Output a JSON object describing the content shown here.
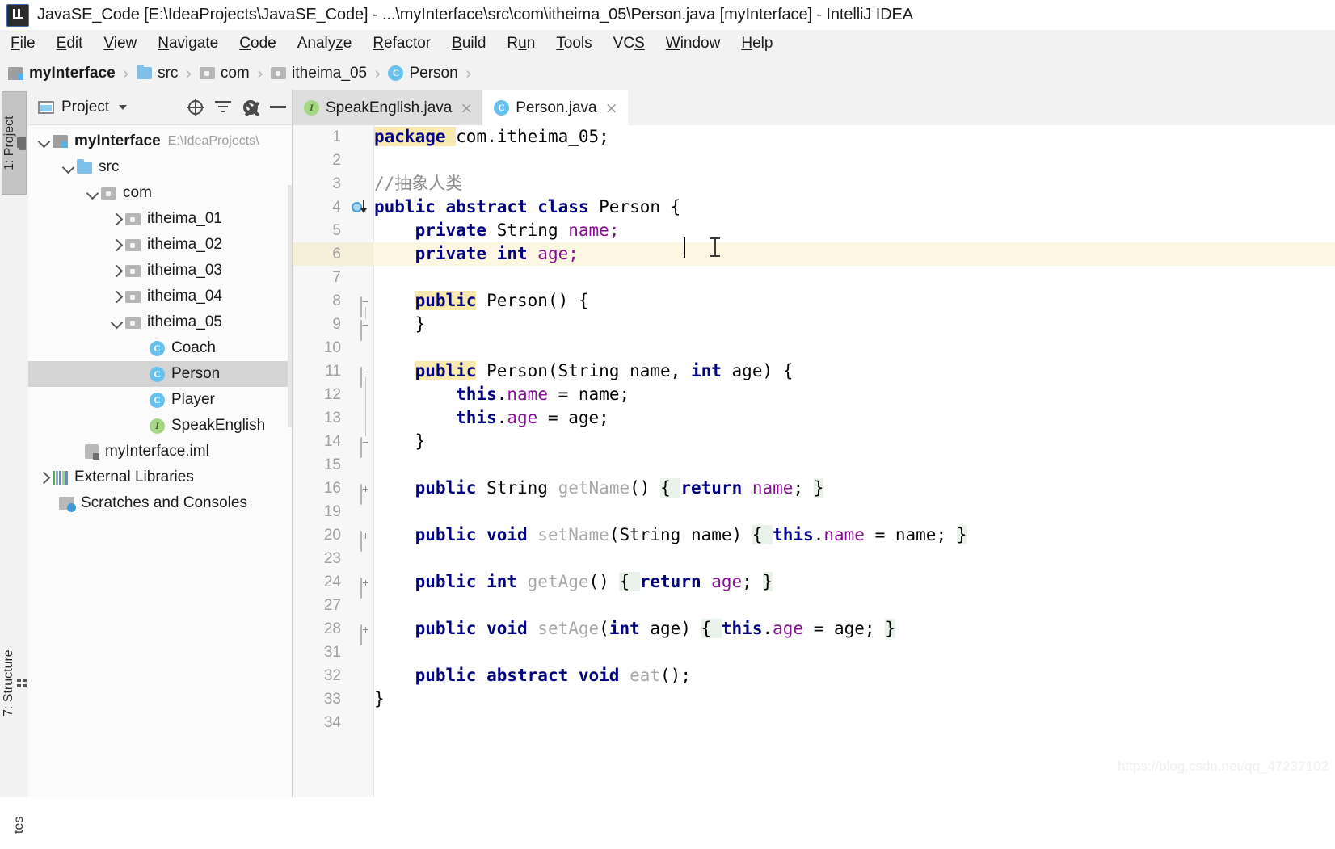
{
  "window": {
    "title": "JavaSE_Code [E:\\IdeaProjects\\JavaSE_Code] - ...\\myInterface\\src\\com\\itheima_05\\Person.java [myInterface] - IntelliJ IDEA",
    "app_name": "IntelliJ IDEA",
    "logo_icon": "intellij-idea-logo-icon"
  },
  "menubar": {
    "items": [
      {
        "label": "File",
        "mnemonic": "F"
      },
      {
        "label": "Edit",
        "mnemonic": "E"
      },
      {
        "label": "View",
        "mnemonic": "V"
      },
      {
        "label": "Navigate",
        "mnemonic": "N"
      },
      {
        "label": "Code",
        "mnemonic": "C"
      },
      {
        "label": "Analyze",
        "mnemonic": "z"
      },
      {
        "label": "Refactor",
        "mnemonic": "R"
      },
      {
        "label": "Build",
        "mnemonic": "B"
      },
      {
        "label": "Run",
        "mnemonic": "u"
      },
      {
        "label": "Tools",
        "mnemonic": "T"
      },
      {
        "label": "VCS",
        "mnemonic": "S"
      },
      {
        "label": "Window",
        "mnemonic": "W"
      },
      {
        "label": "Help",
        "mnemonic": "H"
      }
    ]
  },
  "breadcrumb": {
    "separator": "›",
    "items": [
      {
        "label": "myInterface",
        "icon": "module-icon",
        "bold": true
      },
      {
        "label": "src",
        "icon": "source-folder-icon",
        "bold": false
      },
      {
        "label": "com",
        "icon": "package-icon",
        "bold": false
      },
      {
        "label": "itheima_05",
        "icon": "package-icon",
        "bold": false
      },
      {
        "label": "Person",
        "icon": "java-class-icon",
        "bold": false
      }
    ]
  },
  "left_toolwindows": [
    {
      "label": "1: Project",
      "icon": "project-folder-icon",
      "active": true
    },
    {
      "label": "7: Structure",
      "icon": "structure-icon",
      "active": false
    },
    {
      "label": "tes",
      "icon": "favorites-icon",
      "active": false
    }
  ],
  "project_panel": {
    "title": "Project",
    "view_icon": "project-view-icon",
    "dropdown_icon": "chevron-down-icon",
    "actions": [
      {
        "name": "locate-in-tree-button",
        "icon": "locate-icon"
      },
      {
        "name": "collapse-all-button",
        "icon": "collapse-all-icon"
      },
      {
        "name": "settings-button",
        "icon": "gear-icon"
      },
      {
        "name": "hide-panel-button",
        "icon": "minimize-icon"
      }
    ],
    "tree": [
      {
        "label": "myInterface",
        "sublabel": "E:\\IdeaProjects\\",
        "indent": 0,
        "arrow": "down",
        "icon": "module-icon",
        "bold": true,
        "selected": false
      },
      {
        "label": "src",
        "sublabel": "",
        "indent": 1,
        "arrow": "down",
        "icon": "source-folder-icon",
        "bold": false,
        "selected": false
      },
      {
        "label": "com",
        "sublabel": "",
        "indent": 2,
        "arrow": "down",
        "icon": "package-icon",
        "bold": false,
        "selected": false
      },
      {
        "label": "itheima_01",
        "sublabel": "",
        "indent": 3,
        "arrow": "right",
        "icon": "package-icon",
        "bold": false,
        "selected": false
      },
      {
        "label": "itheima_02",
        "sublabel": "",
        "indent": 3,
        "arrow": "right",
        "icon": "package-icon",
        "bold": false,
        "selected": false
      },
      {
        "label": "itheima_03",
        "sublabel": "",
        "indent": 3,
        "arrow": "right",
        "icon": "package-icon",
        "bold": false,
        "selected": false
      },
      {
        "label": "itheima_04",
        "sublabel": "",
        "indent": 3,
        "arrow": "right",
        "icon": "package-icon",
        "bold": false,
        "selected": false
      },
      {
        "label": "itheima_05",
        "sublabel": "",
        "indent": 3,
        "arrow": "down",
        "icon": "package-icon",
        "bold": false,
        "selected": false
      },
      {
        "label": "Coach",
        "sublabel": "",
        "indent": 4,
        "arrow": "none",
        "icon": "java-class-icon",
        "bold": false,
        "selected": false
      },
      {
        "label": "Person",
        "sublabel": "",
        "indent": 4,
        "arrow": "none",
        "icon": "java-class-icon",
        "bold": false,
        "selected": true
      },
      {
        "label": "Player",
        "sublabel": "",
        "indent": 4,
        "arrow": "none",
        "icon": "java-class-icon",
        "bold": false,
        "selected": false
      },
      {
        "label": "SpeakEnglish",
        "sublabel": "",
        "indent": 4,
        "arrow": "none",
        "icon": "java-interface-icon",
        "bold": false,
        "selected": false
      },
      {
        "label": "myInterface.iml",
        "sublabel": "",
        "indent": 2,
        "arrow": "none",
        "icon": "iml-file-icon",
        "bold": false,
        "selected": false
      },
      {
        "label": "External Libraries",
        "sublabel": "",
        "indent": 0,
        "arrow": "right",
        "icon": "libraries-icon",
        "bold": false,
        "selected": false
      },
      {
        "label": "Scratches and Consoles",
        "sublabel": "",
        "indent": 1,
        "arrow": "none",
        "icon": "scratches-icon",
        "bold": false,
        "selected": false
      }
    ]
  },
  "editor": {
    "tabs": [
      {
        "label": "SpeakEnglish.java",
        "icon": "java-interface-icon",
        "active": false,
        "close": "×"
      },
      {
        "label": "Person.java",
        "icon": "java-class-icon",
        "active": true,
        "close": "×"
      }
    ],
    "current_line": 6,
    "lines": [
      {
        "num": "1",
        "fold": "none",
        "tokens": [
          {
            "t": "package ",
            "c": "kw-hl"
          },
          {
            "t": "com.itheima_05;",
            "c": "txt"
          }
        ]
      },
      {
        "num": "2",
        "fold": "none",
        "tokens": []
      },
      {
        "num": "3",
        "fold": "none",
        "tokens": [
          {
            "t": "//抽象人类",
            "c": "cmt"
          }
        ]
      },
      {
        "num": "4",
        "fold": "none",
        "gutter": "implemented-by-icon",
        "tokens": [
          {
            "t": "public abstract class ",
            "c": "kw"
          },
          {
            "t": "Person {",
            "c": "txt"
          }
        ]
      },
      {
        "num": "5",
        "fold": "none",
        "tokens": [
          {
            "t": "    ",
            "c": "txt"
          },
          {
            "t": "private ",
            "c": "kw"
          },
          {
            "t": "String ",
            "c": "txt"
          },
          {
            "t": "name;",
            "c": "fld"
          }
        ]
      },
      {
        "num": "6",
        "fold": "none",
        "tokens": [
          {
            "t": "    ",
            "c": "txt"
          },
          {
            "t": "private int ",
            "c": "kw"
          },
          {
            "t": "age;",
            "c": "fld"
          }
        ]
      },
      {
        "num": "7",
        "fold": "none",
        "tokens": []
      },
      {
        "num": "8",
        "fold": "minus",
        "tokens": [
          {
            "t": "    ",
            "c": "txt"
          },
          {
            "t": "public",
            "c": "kw-hl"
          },
          {
            "t": " Person() {",
            "c": "txt"
          }
        ]
      },
      {
        "num": "9",
        "fold": "minus-end",
        "tokens": [
          {
            "t": "    }",
            "c": "txt"
          }
        ]
      },
      {
        "num": "10",
        "fold": "none",
        "tokens": []
      },
      {
        "num": "11",
        "fold": "minus",
        "tokens": [
          {
            "t": "    ",
            "c": "txt"
          },
          {
            "t": "public",
            "c": "kw-hl"
          },
          {
            "t": " Person(String name, ",
            "c": "txt"
          },
          {
            "t": "int",
            "c": "kw"
          },
          {
            "t": " age) {",
            "c": "txt"
          }
        ]
      },
      {
        "num": "12",
        "fold": "none",
        "tokens": [
          {
            "t": "        ",
            "c": "txt"
          },
          {
            "t": "this",
            "c": "kw"
          },
          {
            "t": ".",
            "c": "txt"
          },
          {
            "t": "name",
            "c": "fld"
          },
          {
            "t": " = name;",
            "c": "txt"
          }
        ]
      },
      {
        "num": "13",
        "fold": "none",
        "tokens": [
          {
            "t": "        ",
            "c": "txt"
          },
          {
            "t": "this",
            "c": "kw"
          },
          {
            "t": ".",
            "c": "txt"
          },
          {
            "t": "age",
            "c": "fld"
          },
          {
            "t": " = age;",
            "c": "txt"
          }
        ]
      },
      {
        "num": "14",
        "fold": "minus-end",
        "tokens": [
          {
            "t": "    }",
            "c": "txt"
          }
        ]
      },
      {
        "num": "15",
        "fold": "none",
        "tokens": []
      },
      {
        "num": "16",
        "fold": "plus",
        "tokens": [
          {
            "t": "    ",
            "c": "txt"
          },
          {
            "t": "public ",
            "c": "kw"
          },
          {
            "t": "String ",
            "c": "txt"
          },
          {
            "t": "getName",
            "c": "mth"
          },
          {
            "t": "() ",
            "c": "txt"
          },
          {
            "t": "{ ",
            "c": "fold-bg"
          },
          {
            "t": "return ",
            "c": "kw"
          },
          {
            "t": "name",
            "c": "fld"
          },
          {
            "t": "; ",
            "c": "txt"
          },
          {
            "t": "}",
            "c": "fold-bg"
          }
        ]
      },
      {
        "num": "19",
        "fold": "none",
        "tokens": []
      },
      {
        "num": "20",
        "fold": "plus",
        "tokens": [
          {
            "t": "    ",
            "c": "txt"
          },
          {
            "t": "public void ",
            "c": "kw"
          },
          {
            "t": "setName",
            "c": "mth"
          },
          {
            "t": "(String name) ",
            "c": "txt"
          },
          {
            "t": "{ ",
            "c": "fold-bg"
          },
          {
            "t": "this",
            "c": "kw"
          },
          {
            "t": ".",
            "c": "txt"
          },
          {
            "t": "name",
            "c": "fld"
          },
          {
            "t": " = name; ",
            "c": "txt"
          },
          {
            "t": "}",
            "c": "fold-bg"
          }
        ]
      },
      {
        "num": "23",
        "fold": "none",
        "tokens": []
      },
      {
        "num": "24",
        "fold": "plus",
        "tokens": [
          {
            "t": "    ",
            "c": "txt"
          },
          {
            "t": "public int ",
            "c": "kw"
          },
          {
            "t": "getAge",
            "c": "mth"
          },
          {
            "t": "() ",
            "c": "txt"
          },
          {
            "t": "{ ",
            "c": "fold-bg"
          },
          {
            "t": "return ",
            "c": "kw"
          },
          {
            "t": "age",
            "c": "fld"
          },
          {
            "t": "; ",
            "c": "txt"
          },
          {
            "t": "}",
            "c": "fold-bg"
          }
        ]
      },
      {
        "num": "27",
        "fold": "none",
        "tokens": []
      },
      {
        "num": "28",
        "fold": "plus",
        "tokens": [
          {
            "t": "    ",
            "c": "txt"
          },
          {
            "t": "public void ",
            "c": "kw"
          },
          {
            "t": "setAge",
            "c": "mth"
          },
          {
            "t": "(",
            "c": "txt"
          },
          {
            "t": "int",
            "c": "kw"
          },
          {
            "t": " age) ",
            "c": "txt"
          },
          {
            "t": "{ ",
            "c": "fold-bg"
          },
          {
            "t": "this",
            "c": "kw"
          },
          {
            "t": ".",
            "c": "txt"
          },
          {
            "t": "age",
            "c": "fld"
          },
          {
            "t": " = age; ",
            "c": "txt"
          },
          {
            "t": "}",
            "c": "fold-bg"
          }
        ]
      },
      {
        "num": "31",
        "fold": "none",
        "tokens": []
      },
      {
        "num": "32",
        "fold": "none",
        "tokens": [
          {
            "t": "    ",
            "c": "txt"
          },
          {
            "t": "public abstract void ",
            "c": "kw"
          },
          {
            "t": "eat",
            "c": "mth"
          },
          {
            "t": "();",
            "c": "txt"
          }
        ]
      },
      {
        "num": "33",
        "fold": "none",
        "tokens": [
          {
            "t": "}",
            "c": "txt"
          }
        ]
      },
      {
        "num": "34",
        "fold": "none",
        "tokens": []
      }
    ]
  },
  "watermark": {
    "text": "https://blog.csdn.net/qq_47237102"
  },
  "colors": {
    "keyword": "#000080",
    "field": "#871094",
    "method": "#a8a8a8",
    "comment": "#8c8c8c",
    "current_line_bg": "#fdf6e3",
    "selection_bg": "#d4d4d4",
    "fold_bg": "#e8f2e8",
    "accent": "#3f9ad6"
  }
}
